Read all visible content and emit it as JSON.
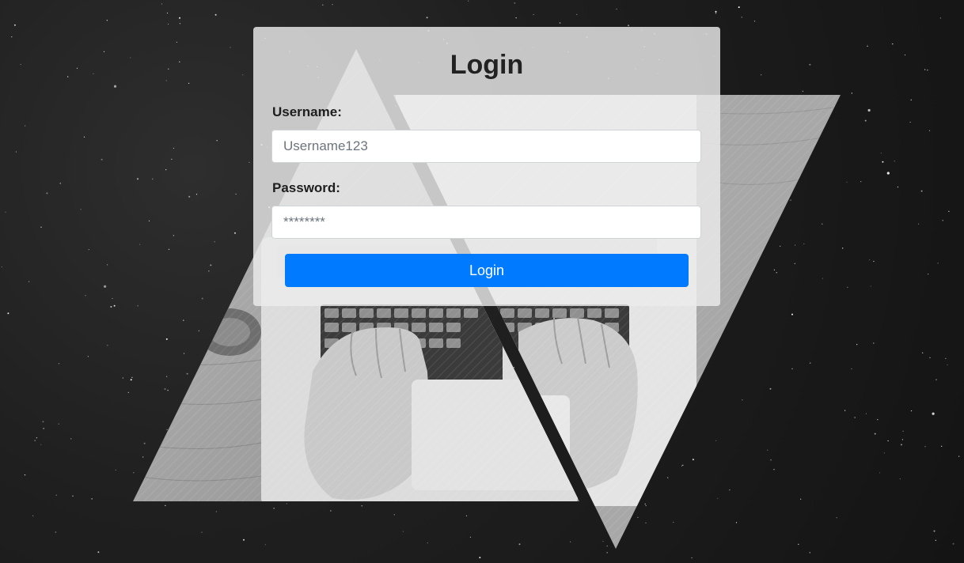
{
  "login_form": {
    "title": "Login",
    "username_label": "Username:",
    "username_placeholder": "Username123",
    "password_label": "Password:",
    "password_placeholder": "********",
    "submit_label": "Login"
  },
  "colors": {
    "primary_button": "#007bff",
    "card_background": "#ebebeb",
    "page_background": "#1a1a1a"
  },
  "background_art": {
    "description_icon": "laptop-typing-photo-triangles"
  }
}
